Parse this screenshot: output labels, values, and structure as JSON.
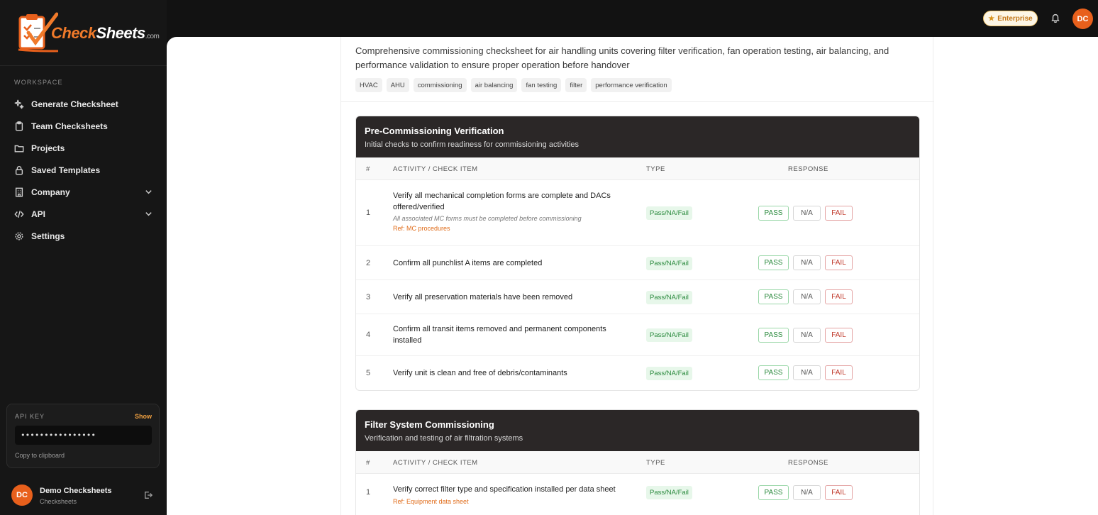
{
  "brand": {
    "name_part1": "Check",
    "name_part2": "Sheets",
    "suffix": ".com"
  },
  "sidebar": {
    "workspace_label": "WORKSPACE",
    "items": [
      {
        "label": "Generate Checksheet",
        "icon": "sparkles-icon"
      },
      {
        "label": "Team Checksheets",
        "icon": "clipboard-icon"
      },
      {
        "label": "Projects",
        "icon": "folder-icon"
      },
      {
        "label": "Saved Templates",
        "icon": "lock-icon"
      },
      {
        "label": "Company",
        "icon": "building-icon"
      },
      {
        "label": "API",
        "icon": "code-icon"
      },
      {
        "label": "Settings",
        "icon": "gear-icon"
      }
    ],
    "api_key": {
      "label": "API KEY",
      "show": "Show",
      "value": "••••••••••••••••",
      "copy": "Copy to clipboard"
    },
    "user": {
      "initials": "DC",
      "name": "Demo Checksheets",
      "org": "Checksheets"
    }
  },
  "topbar": {
    "plan": "Enterprise",
    "initials": "DC"
  },
  "document": {
    "description": "Comprehensive commissioning checksheet for air handling units covering filter verification, fan operation testing, air balancing, and performance validation to ensure proper operation before handover",
    "tags": [
      "HVAC",
      "AHU",
      "commissioning",
      "air balancing",
      "fan testing",
      "filter",
      "performance verification"
    ]
  },
  "table_headers": {
    "num": "#",
    "activity": "ACTIVITY / CHECK ITEM",
    "type": "TYPE",
    "response": "RESPONSE"
  },
  "responses": {
    "pass": "PASS",
    "na": "N/A",
    "fail": "FAIL"
  },
  "sections": [
    {
      "title": "Pre-Commissioning Verification",
      "subtitle": "Initial checks to confirm readiness for commissioning activities",
      "rows": [
        {
          "num": "1",
          "activity": "Verify all mechanical completion forms are complete and DACs offered/verified",
          "note": "All associated MC forms must be completed before commissioning",
          "ref": "Ref: MC procedures",
          "type": "Pass/NA/Fail"
        },
        {
          "num": "2",
          "activity": "Confirm all punchlist A items are completed",
          "type": "Pass/NA/Fail"
        },
        {
          "num": "3",
          "activity": "Verify all preservation materials have been removed",
          "type": "Pass/NA/Fail"
        },
        {
          "num": "4",
          "activity": "Confirm all transit items removed and permanent components installed",
          "type": "Pass/NA/Fail"
        },
        {
          "num": "5",
          "activity": "Verify unit is clean and free of debris/contaminants",
          "type": "Pass/NA/Fail"
        }
      ]
    },
    {
      "title": "Filter System Commissioning",
      "subtitle": "Verification and testing of air filtration systems",
      "rows": [
        {
          "num": "1",
          "activity": "Verify correct filter type and specification installed per data sheet",
          "ref": "Ref: Equipment data sheet",
          "type": "Pass/NA/Fail"
        }
      ]
    }
  ]
}
